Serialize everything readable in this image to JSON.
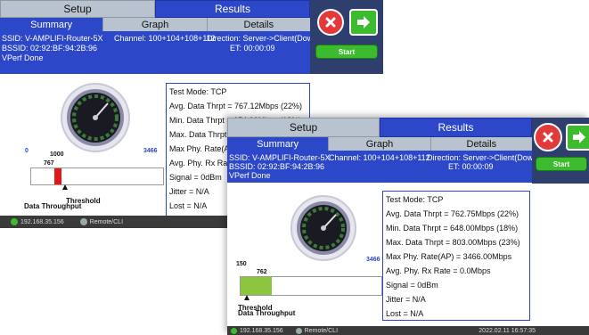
{
  "colors": {
    "accent_blue": "#2c48c9",
    "tab_gray": "#b8c3cf",
    "side_navy": "#2e3f6e",
    "close_red": "#e23a3a",
    "go_green": "#3dbb2f",
    "bar_red": "#e01818",
    "bar_green": "#8cc63f"
  },
  "icons": {
    "close": "close-icon",
    "next": "right-arrow-icon",
    "network": "network-icon",
    "remote": "remote-cli-icon"
  },
  "back": {
    "tabs": {
      "setup": "Setup",
      "results": "Results"
    },
    "subtabs": {
      "summary": "Summary",
      "graph": "Graph",
      "details": "Details"
    },
    "info": {
      "ssid": "SSID: V-AMPLIFI-Router-5X",
      "bssid": "BSSID: 02:92:BF:94:2B:96",
      "status": "VPerf Done",
      "channel": "Channel: 100+104+108+112",
      "direction": "Direction: Server->Client(Dow",
      "et": "ET: 00:00:09"
    },
    "start": "Start",
    "results": [
      "Test Mode: TCP",
      "Avg. Data Thrpt = 767.12Mbps (22%)",
      "Min. Data Thrpt = 654.00Mbps (18%)",
      "Max. Data Thrpt =",
      "Max Phy. Rate(AP)",
      "Avg. Phy. Rx Rate",
      "Signal = 0dBm",
      "Jitter = N/A",
      "Lost = N/A"
    ],
    "scale": {
      "min": "0",
      "max": "3466",
      "threshold": "1000",
      "value": "767"
    },
    "bar": {
      "value": 767,
      "threshold": 1000,
      "max": 3466
    },
    "labels": {
      "data_throughput": "Data Throughput",
      "threshold": "Threshold"
    },
    "footer": {
      "ip": "192.168.35.156",
      "remote": "Remote/CLI"
    }
  },
  "front": {
    "tabs": {
      "setup": "Setup",
      "results": "Results"
    },
    "subtabs": {
      "summary": "Summary",
      "graph": "Graph",
      "details": "Details"
    },
    "info": {
      "ssid": "SSID: V-AMPLIFI-Router-5X",
      "bssid": "BSSID: 02:92:BF:94:2B:96",
      "status": "VPerf Done",
      "channel": "Channel: 100+104+108+112",
      "direction": "Direction: Server->Client(Dow",
      "et": "ET: 00:00:09"
    },
    "start": "Start",
    "results": [
      "Test Mode: TCP",
      "Avg. Data Thrpt = 762.75Mbps (22%)",
      "Min. Data Thrpt = 648.00Mbps (18%)",
      "Max. Data Thrpt = 803.00Mbps (23%)",
      "Max Phy. Rate(AP) = 3466.00Mbps",
      "Avg. Phy. Rx Rate = 0.0Mbps",
      "Signal = 0dBm",
      "Jitter = N/A",
      "Lost = N/A"
    ],
    "scale": {
      "min": "150",
      "max": "3466",
      "value": "762"
    },
    "bar": {
      "value": 762,
      "threshold": 150,
      "max": 3466
    },
    "labels": {
      "data_throughput": "Data Throughput",
      "threshold": "Threshold"
    },
    "footer": {
      "ip": "192.168.35.156",
      "remote": "Remote/CLI",
      "datetime": "2022.02.11  16:57:35"
    }
  }
}
